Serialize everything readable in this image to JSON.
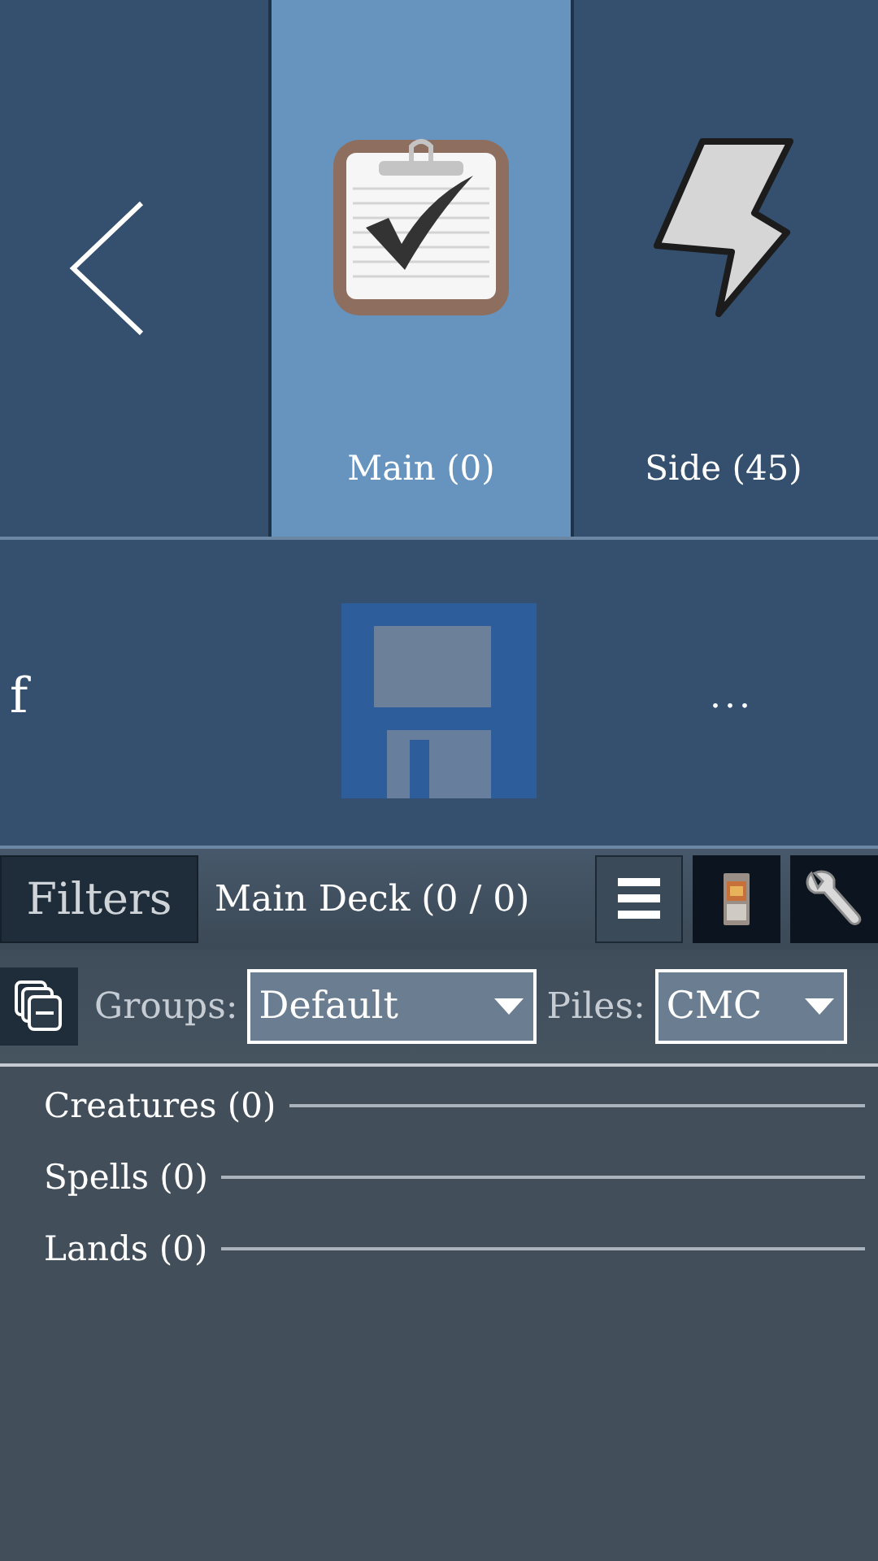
{
  "tabs": [
    {
      "kind": "main",
      "label": "Main (0)",
      "selected": true
    },
    {
      "kind": "side",
      "label": "Side (45)",
      "selected": false
    }
  ],
  "actions": [
    {
      "kind": "text",
      "label": "f"
    },
    {
      "kind": "save"
    },
    {
      "kind": "text",
      "label": "..."
    }
  ],
  "toolbar": {
    "filters_button": "Filters",
    "deck_title": "Main Deck (0 / 0)"
  },
  "options": {
    "groups_label": "Groups:",
    "groups_value": "Default",
    "piles_label": "Piles:",
    "piles_value": "CMC"
  },
  "sections": [
    {
      "label": "Creatures (0)"
    },
    {
      "label": "Spells (0)"
    },
    {
      "label": "Lands (0)"
    }
  ]
}
